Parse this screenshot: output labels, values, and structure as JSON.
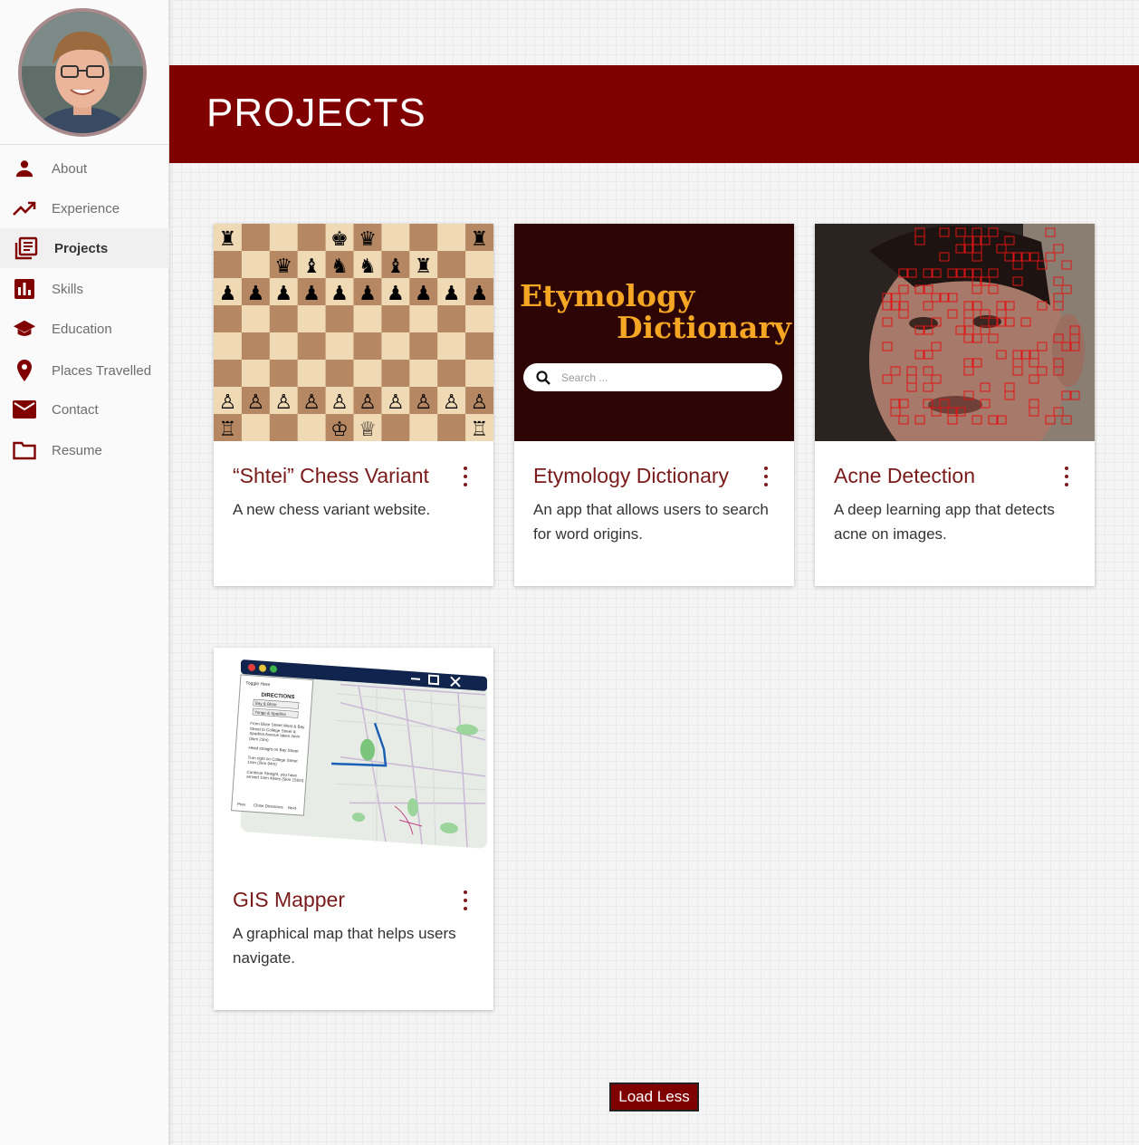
{
  "sidebar": {
    "items": [
      {
        "label": "About",
        "icon": "person-icon"
      },
      {
        "label": "Experience",
        "icon": "trending-up-icon"
      },
      {
        "label": "Projects",
        "icon": "library-books-icon",
        "active": true
      },
      {
        "label": "Skills",
        "icon": "bar-chart-icon"
      },
      {
        "label": "Education",
        "icon": "graduation-cap-icon"
      },
      {
        "label": "Places Travelled",
        "icon": "location-pin-icon"
      },
      {
        "label": "Contact",
        "icon": "mail-icon"
      },
      {
        "label": "Resume",
        "icon": "folder-icon"
      }
    ]
  },
  "header": {
    "title": "PROJECTS"
  },
  "cards": [
    {
      "title": "“Shtei” Chess Variant",
      "description": "A new chess variant website."
    },
    {
      "title": "Etymology Dictionary",
      "description": "An app that allows users to search for word origins."
    },
    {
      "title": "Acne Detection",
      "description": "A deep learning app that detects acne on images."
    },
    {
      "title": "GIS Mapper",
      "description": "A graphical map that helps users navigate."
    }
  ],
  "etymology_image": {
    "line1": "Etymology",
    "line2": "Dictionary",
    "search_placeholder": "Search ..."
  },
  "gis_image": {
    "panel_title": "DIRECTIONS",
    "from": "Bay & Bloor",
    "to": "Yonge & Spadina",
    "steps": [
      "From Bloor Street West & Bay Street to College Street & Spadina Avenue takes 3min (5km 23m)",
      "Head straight on Bay Street",
      "Turn right on College Street 1min (2km 94m)",
      "Continue Straight, you have arrived 1min 40sec (5km 156m)"
    ],
    "prev": "Prev",
    "close": "Close Directions",
    "next": "Next",
    "toggle": "Toggle Here"
  },
  "load_button": "Load Less",
  "colors": {
    "brand": "#800000",
    "title": "#7b1a1a",
    "etym_bg": "#2e0505",
    "etym_text": "#f5a623"
  }
}
